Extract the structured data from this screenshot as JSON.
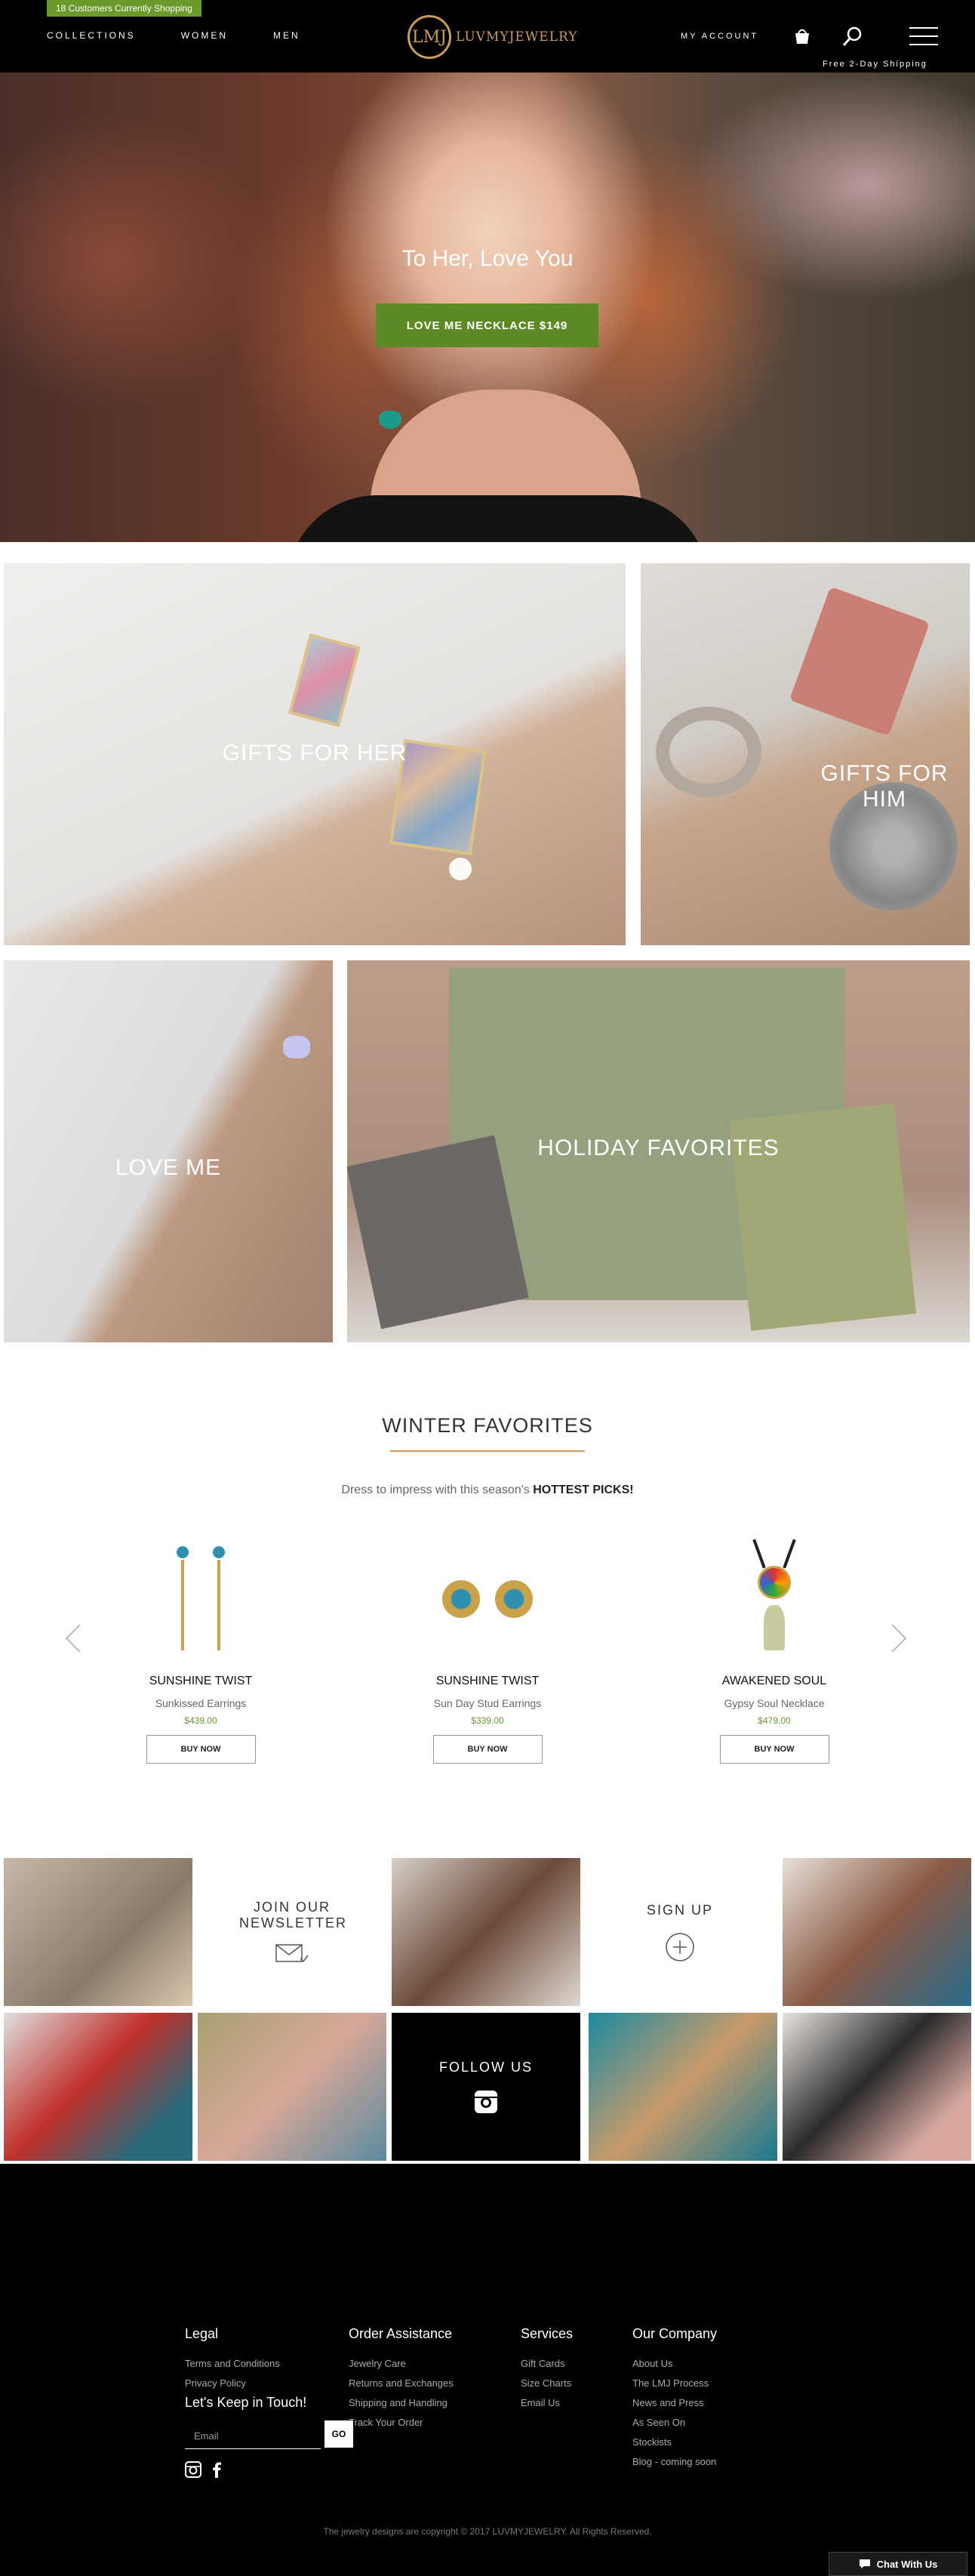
{
  "header": {
    "shoppers_badge": "18 Customers Currently Shopping",
    "nav": [
      "COLLECTIONS",
      "WOMEN",
      "MEN"
    ],
    "logo_mark": "LMJ",
    "logo_text": "LUVMYJEWELRY",
    "account": "MY ACCOUNT",
    "free_shipping": "Free 2-Day Shipping",
    "icons": [
      "shopping-bag-icon",
      "search-icon",
      "menu-icon"
    ]
  },
  "hero": {
    "tagline": "To Her, Love You",
    "cta": "LOVE ME NECKLACE $149"
  },
  "categories": [
    {
      "label": "GIFTS FOR HER"
    },
    {
      "label": "GIFTS FOR HIM"
    },
    {
      "label": "LOVE ME"
    },
    {
      "label": "HOLIDAY FAVORITES"
    }
  ],
  "winter": {
    "title": "WINTER FAVORITES",
    "subtitle": "Dress to impress with this season's",
    "subtitle_bold": "HOTTEST PICKS!",
    "products": [
      {
        "name": "SUNSHINE TWIST",
        "desc": "Sunkissed Earrings",
        "price": "$439.00",
        "button": "BUY NOW"
      },
      {
        "name": "SUNSHINE TWIST",
        "desc": "Sun Day Stud Earrings",
        "price": "$339.00",
        "button": "BUY NOW"
      },
      {
        "name": "AWAKENED SOUL",
        "desc": "Gypsy Soul Necklace",
        "price": "$479.00",
        "button": "BUY NOW"
      }
    ]
  },
  "social_grid": {
    "newsletter": "JOIN OUR NEWSLETTER",
    "signup": "SIGN UP",
    "follow": "FOLLOW US"
  },
  "footer": {
    "legal": {
      "title": "Legal",
      "links": [
        "Terms and Conditions",
        "Privacy Policy"
      ]
    },
    "order": {
      "title": "Order Assistance",
      "links": [
        "Jewelry Care",
        "Returns and Exchanges",
        "Shipping and Handling",
        "Track Your Order"
      ]
    },
    "services": {
      "title": "Services",
      "links": [
        "Gift Cards",
        "Size Charts",
        "Email Us"
      ]
    },
    "company": {
      "title": "Our Company",
      "links": [
        "About Us",
        "The LMJ Process",
        "News and Press",
        "As Seen On",
        "Stockists",
        "Blog - coming soon"
      ]
    },
    "keep_in_touch": "Let's Keep in Touch!",
    "email_placeholder": "Email",
    "go": "GO",
    "copyright": "The jewelry designs are copyright © 2017 LUVMYJEWELRY. All Rights Reserved.",
    "chat": "Chat With Us"
  }
}
